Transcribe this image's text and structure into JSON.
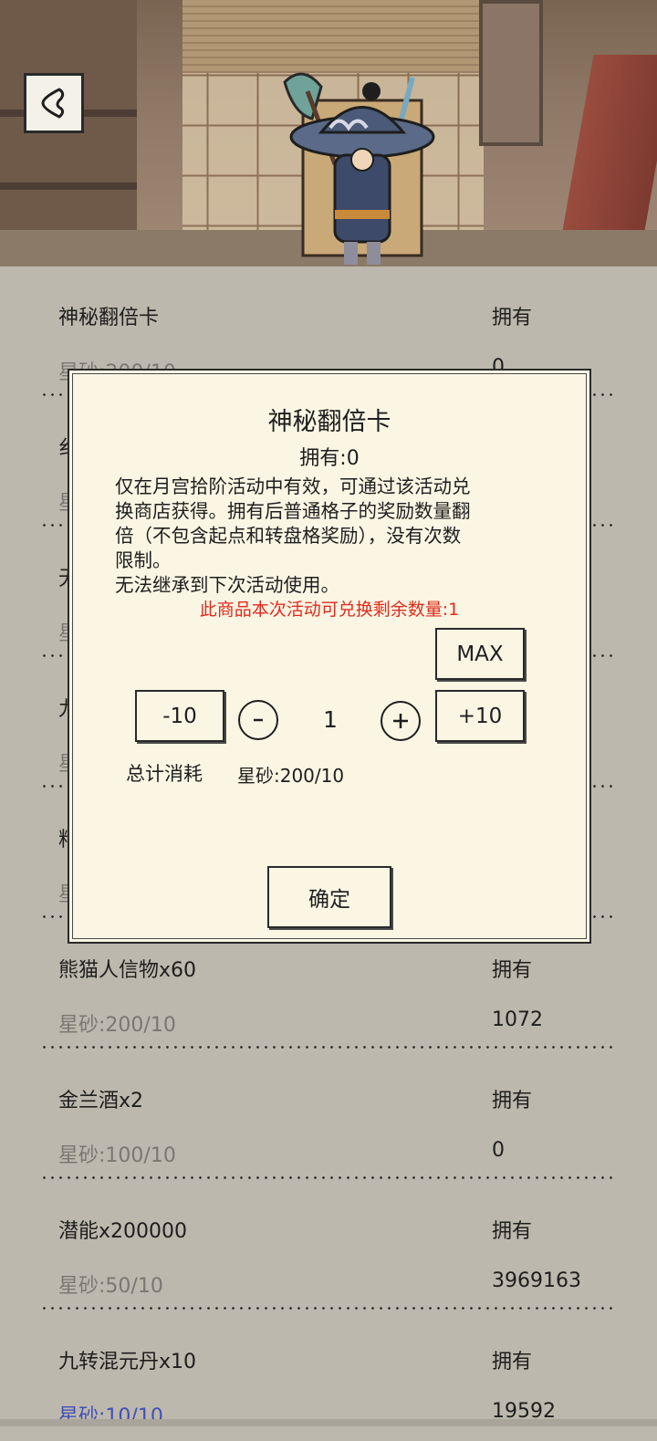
{
  "list": {
    "own_label": "拥有",
    "items": [
      {
        "name": "神秘翻倍卡",
        "price": "星砂:200/10",
        "owned": "0"
      },
      {
        "name": "纟",
        "price": "星",
        "owned": ""
      },
      {
        "name": "无",
        "price": "星",
        "owned": ""
      },
      {
        "name": "九",
        "price": "星",
        "owned": ""
      },
      {
        "name": "料",
        "price": "星",
        "owned": ""
      },
      {
        "name": "熊猫人信物x60",
        "price": "星砂:200/10",
        "owned": "1072"
      },
      {
        "name": "金兰酒x2",
        "price": "星砂:100/10",
        "owned": "0"
      },
      {
        "name": "潜能x200000",
        "price": "星砂:50/10",
        "owned": "3969163"
      },
      {
        "name": "九转混元丹x10",
        "price": "星砂:10/10",
        "owned": "19592"
      }
    ]
  },
  "dialog": {
    "title": "神秘翻倍卡",
    "owned": "拥有:0",
    "desc_lines": [
      "仅在月宫拾阶活动中有效，可通过该活动兑",
      "换商店获得。拥有后普通格子的奖励数量翻",
      "倍（不包含起点和转盘格奖励），没有次数",
      "限制。",
      "无法继承到下次活动使用。"
    ],
    "remaining": "此商品本次活动可兑换剩余数量:1",
    "max_label": "MAX",
    "minus10_label": "-10",
    "plus10_label": "+10",
    "quantity": "1",
    "total_label": "总计消耗",
    "total_value": "星砂:200/10",
    "confirm_label": "确定"
  },
  "colors": {
    "background": "#bdb8ad",
    "dialog_bg": "#fbf6e4",
    "warning_red": "#e02b1d",
    "price_gray": "#7a7772"
  },
  "icons": [
    "back-arrow-icon",
    "minus-circle-icon",
    "plus-circle-icon"
  ]
}
